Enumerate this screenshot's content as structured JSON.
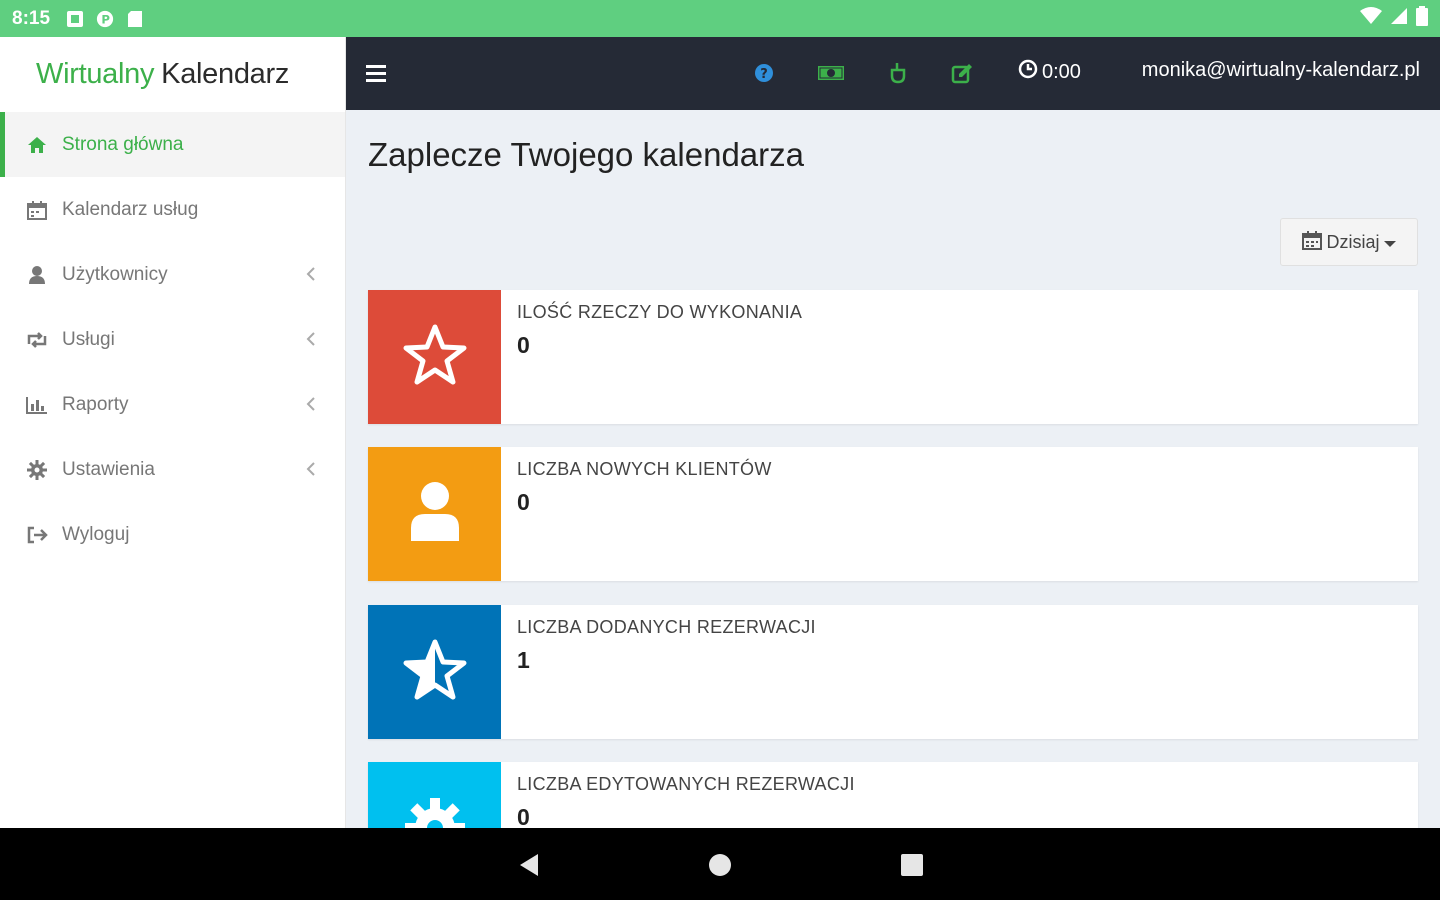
{
  "status_bar": {
    "time": "8:15"
  },
  "logo": {
    "part1": "Wirtualny",
    "part2": "Kalendarz"
  },
  "sidebar": {
    "items": [
      {
        "label": "Strona główna",
        "icon": "home-icon",
        "active": true,
        "has_chevron": false
      },
      {
        "label": "Kalendarz usług",
        "icon": "calendar-icon",
        "active": false,
        "has_chevron": false
      },
      {
        "label": "Użytkownicy",
        "icon": "user-icon",
        "active": false,
        "has_chevron": true
      },
      {
        "label": "Usługi",
        "icon": "retweet-icon",
        "active": false,
        "has_chevron": true
      },
      {
        "label": "Raporty",
        "icon": "bar-chart-icon",
        "active": false,
        "has_chevron": true
      },
      {
        "label": "Ustawienia",
        "icon": "gear-icon",
        "active": false,
        "has_chevron": true
      },
      {
        "label": "Wyloguj",
        "icon": "sign-out-icon",
        "active": false,
        "has_chevron": false
      }
    ]
  },
  "navbar": {
    "timer": "0:00",
    "email": "monika@wirtualny-kalendarz.pl",
    "icons": [
      "help-icon",
      "money-icon",
      "hand-icon",
      "edit-icon"
    ]
  },
  "main": {
    "title": "Zaplecze Twojego kalendarza",
    "date_button": "Dzisiaj",
    "stats": [
      {
        "label": "ILOŚĆ RZECZY DO WYKONANIA",
        "value": "0",
        "color": "#dd4b39",
        "icon": "star-outline-icon"
      },
      {
        "label": "LICZBA NOWYCH KLIENTÓW",
        "value": "0",
        "color": "#f39c12",
        "icon": "user-icon"
      },
      {
        "label": "LICZBA DODANYCH REZERWACJI",
        "value": "1",
        "color": "#0073b7",
        "icon": "star-half-icon"
      },
      {
        "label": "LICZBA EDYTOWANYCH REZERWACJI",
        "value": "0",
        "color": "#00c0ef",
        "icon": "gear-icon"
      }
    ]
  },
  "colors": {
    "accent": "#3cb04a",
    "status_bar": "#5fcf80",
    "navbar": "#252a36",
    "background": "#ecf0f5"
  }
}
